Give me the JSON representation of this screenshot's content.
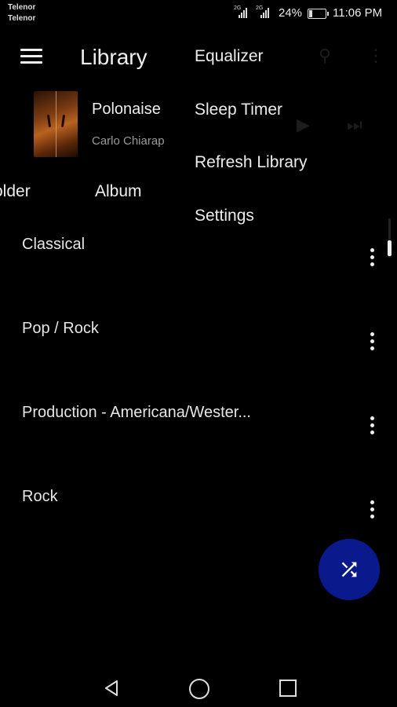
{
  "status_bar": {
    "carrier1": "Telenor",
    "carrier2": "Telenor",
    "sim1_net": "2G",
    "sim2_net": "2G",
    "battery": "24%",
    "battery_level": 0.24,
    "time": "11:06 PM"
  },
  "app_bar": {
    "menu_icon": "hamburger-menu-icon",
    "title": "Library"
  },
  "now_playing": {
    "title": "Polonaise",
    "artist": "Carlo Chiarap",
    "cover_icon": "violin-album-art"
  },
  "tabs": [
    "older",
    "Album"
  ],
  "overflow_menu": {
    "items": [
      "Equalizer",
      "Sleep Timer",
      "Refresh Library",
      "Settings"
    ]
  },
  "genres": [
    {
      "label": "Classical",
      "more_icon": "more-vert-icon"
    },
    {
      "label": "Pop / Rock",
      "more_icon": "more-vert-icon"
    },
    {
      "label": "Production - Americana/Wester...",
      "more_icon": "more-vert-icon"
    },
    {
      "label": "Rock",
      "more_icon": "more-vert-icon"
    }
  ],
  "fab": {
    "icon": "shuffle-icon"
  },
  "nav_bar": {
    "back_icon": "back-icon",
    "home_icon": "home-icon",
    "recents_icon": "recents-icon"
  },
  "colors": {
    "background": "#000000",
    "fab": "#0a1a8c",
    "text": "#e6e6e6",
    "secondary_text": "#9a9a9a"
  }
}
